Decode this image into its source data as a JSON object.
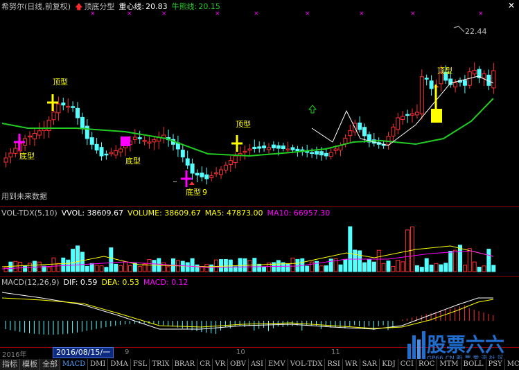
{
  "main_header": {
    "stock": "希努尔(日线,前复权)",
    "indicator_name": "顶底分型",
    "center_label": "重心线:",
    "center_value": "20.83",
    "bull_label": "牛熊线:",
    "bull_value": "20.15"
  },
  "main_annotations": {
    "top1": "顶型",
    "top2": "顶型",
    "top3": "顶型",
    "bottom1": "底型",
    "bottom2": "底型",
    "bottom3": "底型",
    "bottom3_suffix": "9",
    "high_price": "22.44",
    "future_label": "用到未来数据"
  },
  "vol_header": {
    "name": "VOL-TDX(5,10)",
    "vvol": "VVOL: 38609.67",
    "volume": "VOLUME: 38609.67",
    "ma5": "MA5: 47873.00",
    "ma10": "MA10: 66957.30"
  },
  "macd_header": {
    "name": "MACD(12,26,9)",
    "dif": "DIF: 0.59",
    "dea": "DEA: 0.53",
    "macd": "MACD: 0.12"
  },
  "time_axis": {
    "year": "2016年",
    "selected_date": "2016/08/15/一",
    "month9": "9",
    "month10": "10",
    "month11": "11"
  },
  "tabs": [
    "指标",
    "模板",
    "全部",
    "MACD",
    "DMI",
    "DMA",
    "FSL",
    "TRIX",
    "BRAR",
    "CR",
    "VR",
    "OBV",
    "ASI",
    "EMV",
    "VOL-TDX",
    "RSI",
    "WR",
    "SAR",
    "KDJ",
    "CCI",
    "ROC",
    "MTM",
    "BOLL",
    "PSY",
    "MCST"
  ],
  "watermark": {
    "main": "股票六六",
    "sub": "GP66.CN 股 票 爱 流 社 区"
  },
  "colors": {
    "up": "#ff3232",
    "down": "#54ffff",
    "bull_line": "#22cc22",
    "yellow": "#ffff00",
    "magenta": "#ff00ff",
    "white": "#ffffff"
  }
}
